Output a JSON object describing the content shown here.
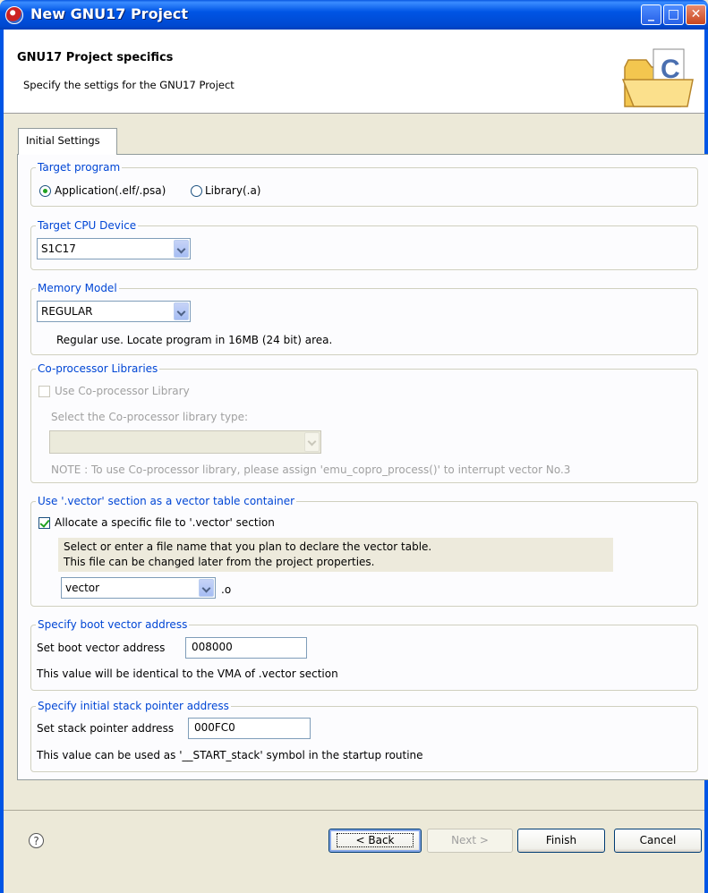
{
  "window": {
    "title": "New GNU17 Project",
    "min_glyph": "_",
    "max_glyph": "□",
    "close_glyph": "✕"
  },
  "header": {
    "title": "GNU17 Project specifics",
    "description": "Specify the settigs for the GNU17 Project",
    "icon_letter": "C",
    "icon": "folder-c-icon"
  },
  "tabs": [
    {
      "label": "Initial Settings",
      "active": true
    }
  ],
  "target_program": {
    "title": "Target program",
    "options": [
      {
        "label": "Application(.elf/.psa)",
        "selected": true
      },
      {
        "label": "Library(.a)",
        "selected": false
      }
    ]
  },
  "target_cpu": {
    "title": "Target CPU Device",
    "value": "S1C17"
  },
  "memory_model": {
    "title": "Memory Model",
    "value": "REGULAR",
    "description": "Regular use. Locate program in 16MB (24 bit) area."
  },
  "coprocessor": {
    "title": "Co-processor Libraries",
    "checkbox_label": "Use Co-processor Library",
    "checked": false,
    "type_label": "Select the Co-processor library type:",
    "type_value": "",
    "note": "NOTE : To use Co-processor library, please assign 'emu_copro_process()' to interrupt vector No.3"
  },
  "vector_section": {
    "title": "Use '.vector' section as a vector table container",
    "checkbox_label": "Allocate a specific file to '.vector' section",
    "checked": true,
    "hint_line1": "Select or enter a file name that you plan to declare the vector table.",
    "hint_line2": "This file can be changed later from the project properties.",
    "file_value": "vector",
    "file_suffix": ".o"
  },
  "boot_vector": {
    "title": "Specify boot vector address",
    "label": "Set boot vector address",
    "value": "008000",
    "note": "This value will be identical to the VMA of .vector section"
  },
  "stack_pointer": {
    "title": "Specify initial stack pointer address",
    "label": "Set stack pointer address",
    "value": "000FC0",
    "note": "This value can be used as '__START_stack' symbol in the startup routine"
  },
  "buttons": {
    "help": "?",
    "back": "< Back",
    "next": "Next >",
    "finish": "Finish",
    "cancel": "Cancel"
  },
  "colors": {
    "titlebar": "#0055E5",
    "group_title": "#0046D5",
    "radio_dot": "#21A121"
  }
}
